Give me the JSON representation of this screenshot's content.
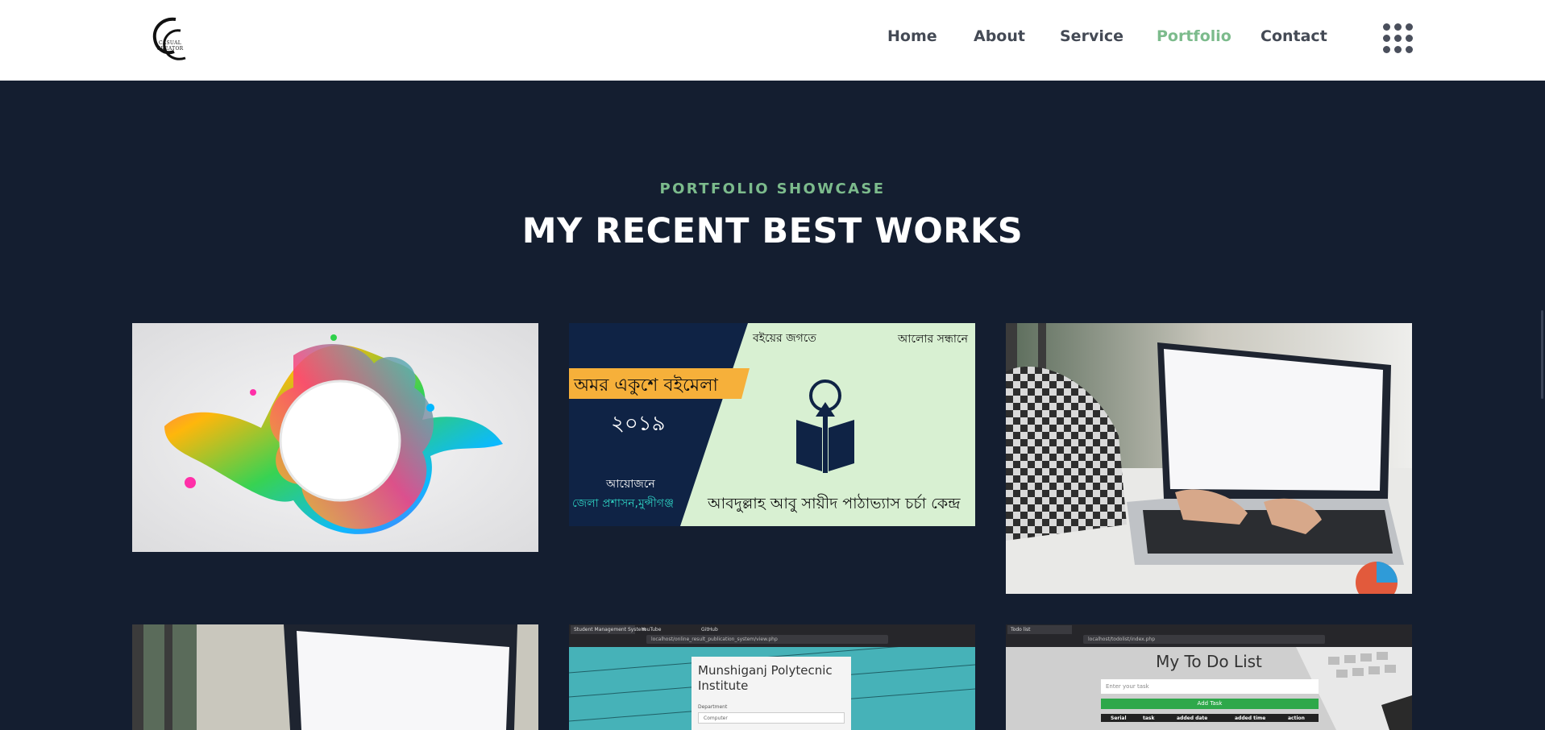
{
  "brand": {
    "logo_text": "CASUAL CREATOR"
  },
  "nav": {
    "items": [
      {
        "label": "Home",
        "active": false
      },
      {
        "label": "About",
        "active": false
      },
      {
        "label": "Service",
        "active": false
      },
      {
        "label": "Portfolio",
        "active": true
      },
      {
        "label": "Contact",
        "active": false
      }
    ],
    "menu_icon": "grid-dots-icon"
  },
  "section": {
    "eyebrow": "PORTFOLIO SHOWCASE",
    "title": "MY RECENT BEST WORKS"
  },
  "portfolio": {
    "banner": {
      "top_left": "বইয়ের জগতে",
      "top_right": "আলোর সন্ধানে",
      "ribbon": "অমর একুশে বইমেলা",
      "year": "২০১৯",
      "organizer_label": "আয়োজনে",
      "organizer": "জেলা প্রশাসন,মুন্সীগঞ্জ",
      "bottom": "আবদুল্লাহ আবু সায়ীদ পাঠাভ্যাস চর্চা কেন্দ্র"
    },
    "result_app": {
      "tabs": [
        "Student Management System",
        "YouTube",
        "GitHub"
      ],
      "url": "localhost/online_result_publication_system/view.php",
      "heading": "Munshiganj Polytecnic Institute",
      "department_label": "Department",
      "department_value": "Computer"
    },
    "todo_app": {
      "tab": "Todo list",
      "url": "localhost/todolist/index.php",
      "heading": "My To Do List",
      "input_placeholder": "Enter your task",
      "add_label": "Add Task",
      "columns": [
        "Serial",
        "task",
        "added date",
        "added time",
        "action"
      ]
    }
  },
  "colors": {
    "background": "#141e30",
    "accent": "#7cbb8c",
    "header": "#ffffff"
  }
}
